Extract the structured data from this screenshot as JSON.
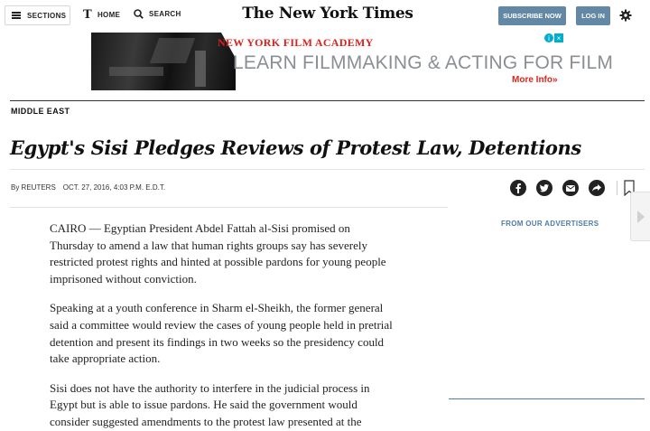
{
  "header": {
    "sections_label": "SECTIONS",
    "home_label": "HOME",
    "search_label": "SEARCH",
    "masthead": "The New York Times",
    "subscribe_label": "SUBSCRIBE NOW",
    "login_label": "LOG IN"
  },
  "ad": {
    "brand": "NEW YORK FILM ACADEMY",
    "tagline": "LEARN FILMMAKING & ACTING FOR FILM",
    "more": "More Info»"
  },
  "article": {
    "kicker": "MIDDLE EAST",
    "headline": "Egypt's Sisi Pledges Reviews of Protest Law, Detentions",
    "byline": "By REUTERS",
    "timestamp": "OCT. 27, 2016, 4:03 P.M. E.D.T.",
    "paragraphs": [
      "CAIRO — Egyptian President Abdel Fattah al-Sisi promised on Thursday to amend a law that human rights groups say has severely restricted protest rights and hinted at possible pardons for young people imprisoned without conviction.",
      "Speaking at a youth conference in Sharm el-Sheikh, the former general said a committee would review the cases of young people held in pretrial detention and present its findings in two weeks so the presidency could take appropriate action.",
      "Sisi does not have the authority to interfere in the judicial process in Egypt but is able to issue pardons. He said the government would consider suggested amendments to the protest law presented at the"
    ]
  },
  "sidebar": {
    "from_advertisers": "FROM OUR ADVERTISERS"
  },
  "colors": {
    "button_blue": "#6288a5",
    "ad_red": "#e0201c",
    "advertiser_label": "#4f7ca8"
  },
  "icons": {
    "share": [
      "facebook-icon",
      "twitter-icon",
      "email-icon",
      "share-icon"
    ],
    "save": "bookmark-icon",
    "settings": "gear-icon"
  }
}
